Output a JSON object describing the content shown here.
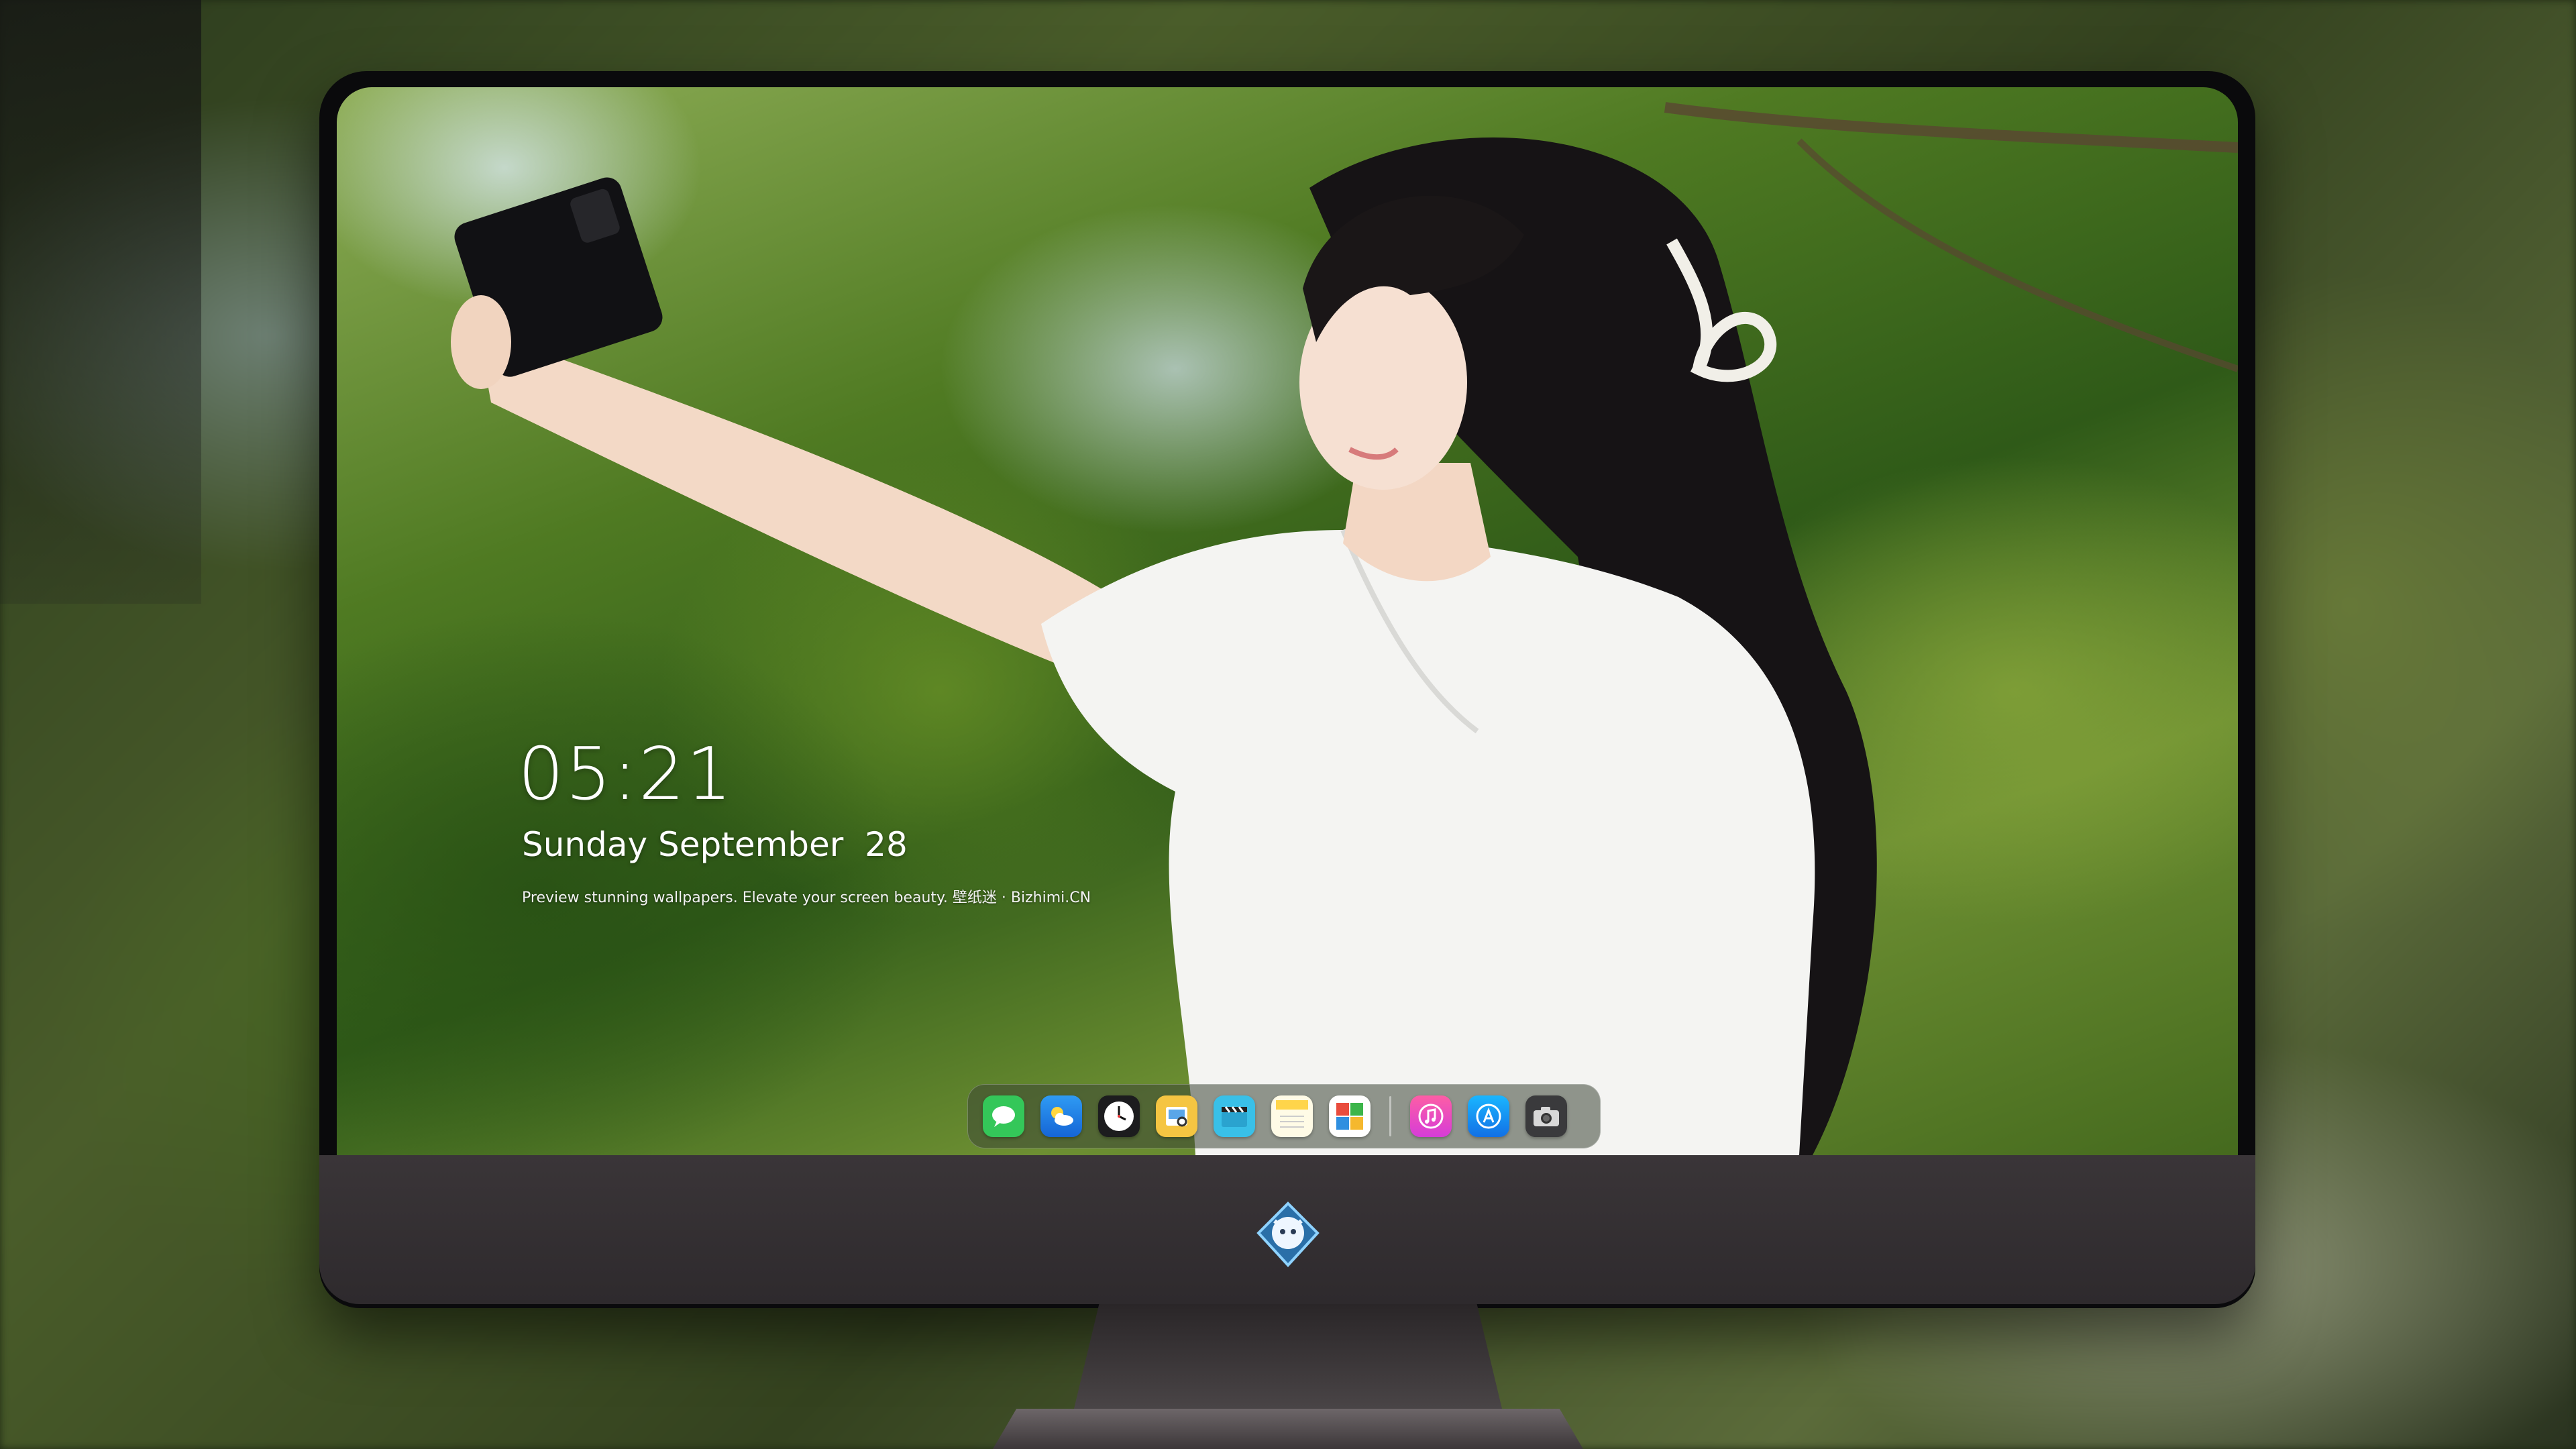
{
  "lock_screen": {
    "time": "05:21",
    "date": "Sunday September  28",
    "tagline": "Preview stunning wallpapers. Elevate your screen beauty. 壁纸迷 · Bizhimi.CN"
  },
  "dock": {
    "apps": [
      {
        "name": "messages-icon",
        "color": "#34c759"
      },
      {
        "name": "weather-icon",
        "color": "#2b8ef0"
      },
      {
        "name": "clock-icon",
        "color": "#ffffff"
      },
      {
        "name": "preview-icon",
        "color": "#f5c542"
      },
      {
        "name": "clips-icon",
        "color": "#39c0e8"
      },
      {
        "name": "notes-icon",
        "color": "#ffd54a"
      },
      {
        "name": "photo-booth-icon",
        "color": "#e94c3d"
      },
      {
        "name": "music-icon",
        "color": "#fc3c8d"
      },
      {
        "name": "app-store-icon",
        "color": "#1e8ef7"
      },
      {
        "name": "camera-icon",
        "color": "#3a3a3c"
      }
    ]
  },
  "monitor": {
    "logo": "mascot-logo-icon"
  }
}
